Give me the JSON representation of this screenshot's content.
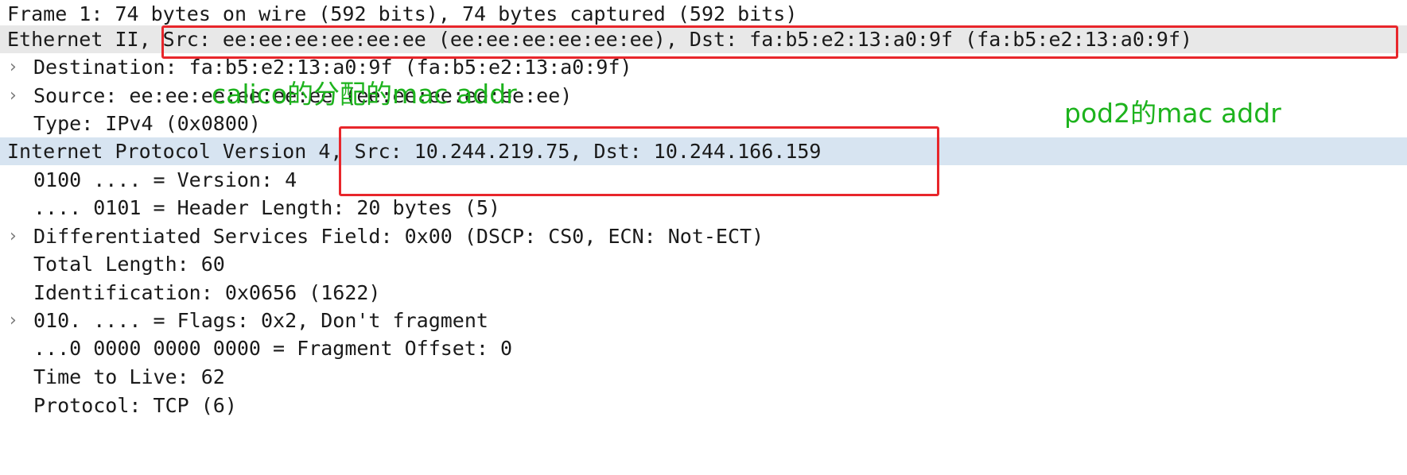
{
  "tree": {
    "rows": [
      {
        "text": "Frame 1: 74 bytes on wire (592 bits), 74 bytes captured (592 bits)",
        "expandable": false
      },
      {
        "text": "Ethernet II, Src: ee:ee:ee:ee:ee:ee (ee:ee:ee:ee:ee:ee), Dst: fa:b5:e2:13:a0:9f (fa:b5:e2:13:a0:9f)",
        "expandable": false
      },
      {
        "text": "Destination: fa:b5:e2:13:a0:9f (fa:b5:e2:13:a0:9f)",
        "expandable": true
      },
      {
        "text": "Source: ee:ee:ee:ee:ee:ee (ee:ee:ee:ee:ee:ee)",
        "expandable": true
      },
      {
        "text": "Type: IPv4 (0x0800)",
        "expandable": false
      },
      {
        "text": "Internet Protocol Version 4, Src: 10.244.219.75, Dst: 10.244.166.159",
        "expandable": false
      },
      {
        "text": "0100 .... = Version: 4",
        "expandable": false
      },
      {
        "text": ".... 0101 = Header Length: 20 bytes (5)",
        "expandable": false
      },
      {
        "text": "Differentiated Services Field: 0x00 (DSCP: CS0, ECN: Not-ECT)",
        "expandable": true
      },
      {
        "text": "Total Length: 60",
        "expandable": false
      },
      {
        "text": "Identification: 0x0656 (1622)",
        "expandable": false
      },
      {
        "text": "010. .... = Flags: 0x2, Don't fragment",
        "expandable": true
      },
      {
        "text": "...0 0000 0000 0000 = Fragment Offset: 0",
        "expandable": false
      },
      {
        "text": "Time to Live: 62",
        "expandable": false
      },
      {
        "text": "Protocol: TCP (6)",
        "expandable": false
      }
    ],
    "expand_arrow": "›"
  },
  "annotations": {
    "calico_label": "calico的分配的mac addr",
    "pod2_label": "pod2的mac addr",
    "color": "#1db31d",
    "box_color": "#e8262b"
  }
}
